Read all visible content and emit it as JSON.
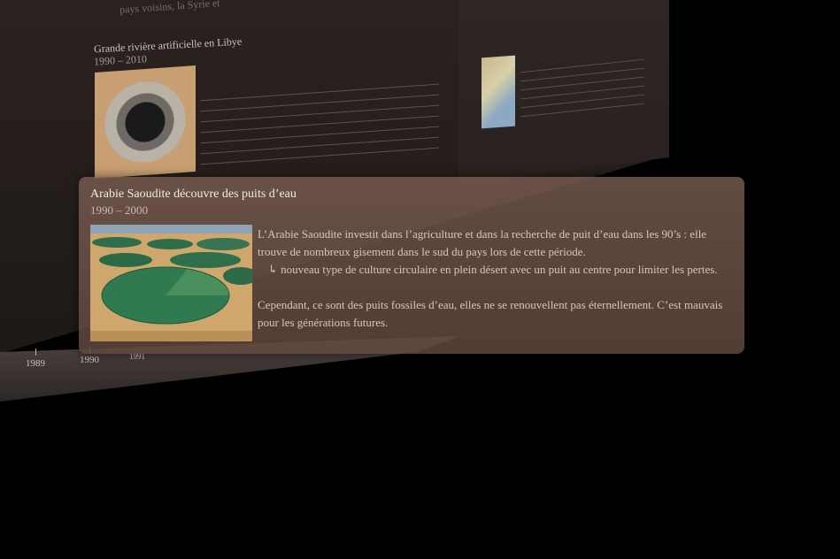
{
  "background": {
    "top_text": "pays voisins, la Syrie et",
    "article_title": "Grande rivière artificielle en Libye",
    "article_date": "1990 – 2010"
  },
  "timeline": {
    "labels": [
      "1989",
      "1990",
      "1991"
    ]
  },
  "card": {
    "title": "Arabie Saoudite découvre des puits d’eau",
    "date": "1990 – 2000",
    "paragraph1": "L’Arabie Saoudite investit dans l’agriculture et dans la recherche de puit d’eau dans les 90’s : elle trouve de nombreux gisement dans le sud du pays lors de cette période.",
    "paragraph2": "↳ nouveau type de culture circulaire en plein désert avec un puit au centre pour limiter les pertes.",
    "paragraph3": "Cependant, ce sont des puits fossiles d’eau, elles ne se renouvellent pas éternellement. C’est mauvais pour les générations futures."
  },
  "colors": {
    "card_bg": "#6a5046",
    "text_primary": "#f3ece8",
    "text_body": "#d8c6bd"
  }
}
